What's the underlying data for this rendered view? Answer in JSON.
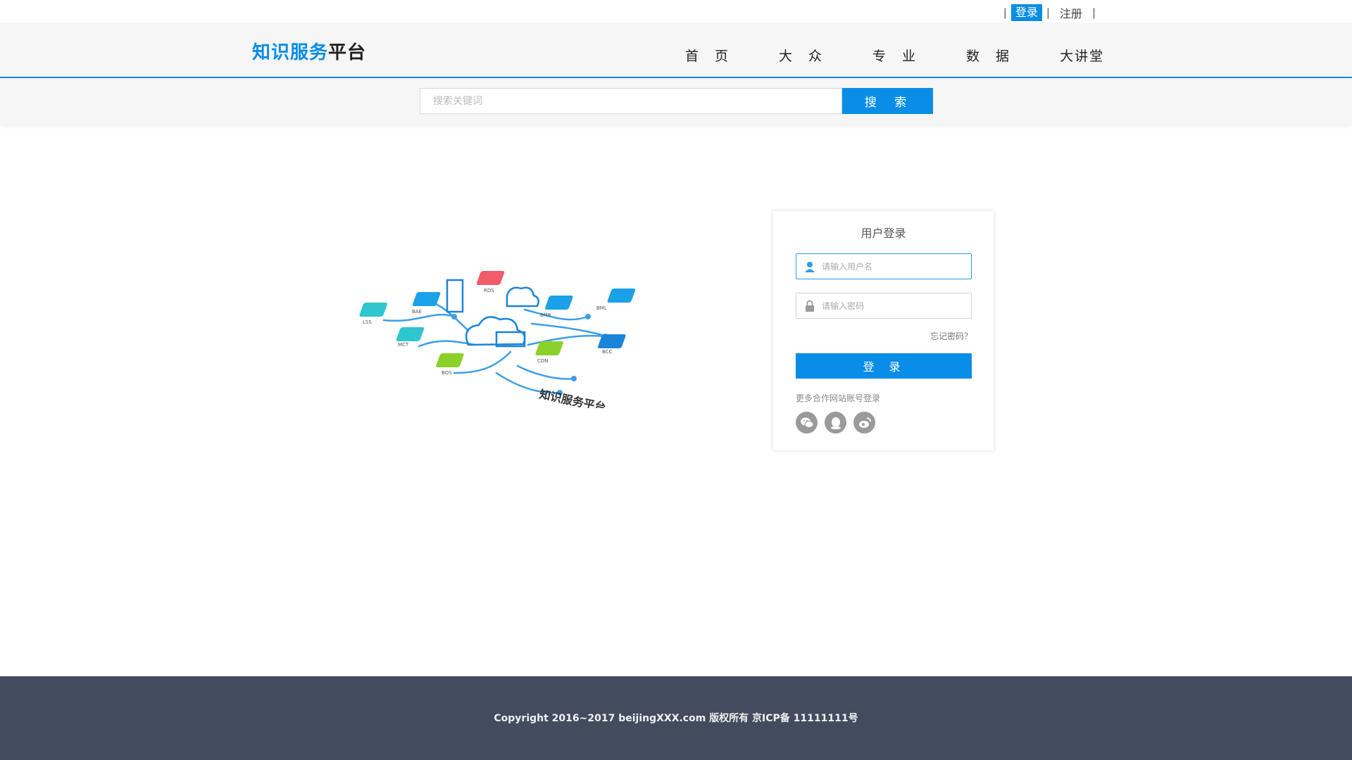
{
  "topbar": {
    "separator": "|",
    "login_label": "登录",
    "register_label": "注册"
  },
  "header": {
    "logo_blue": "知识服务",
    "logo_dark": "平台",
    "nav": [
      "首　页",
      "大　众",
      "专　业",
      "数　据",
      "大讲堂"
    ]
  },
  "search": {
    "placeholder": "搜索关键词",
    "button_label": "搜 索"
  },
  "illustration": {
    "tags": [
      "RDS",
      "BAE",
      "LSS",
      "MCT",
      "BOS",
      "CDN",
      "BMR",
      "BML",
      "BCC"
    ],
    "caption": "知识服务平台"
  },
  "login": {
    "title": "用户登录",
    "username_placeholder": "请输入用户名",
    "password_placeholder": "请输入密码",
    "forgot_label": "忘记密码？",
    "submit_label": "登 录",
    "partner_text": "更多合作网站账号登录",
    "socials": [
      "wechat-icon",
      "qq-icon",
      "weibo-icon"
    ]
  },
  "footer": {
    "copyright": "Copyright 2016~2017 beijingXXX.com 版权所有 京ICP备 11111111号"
  },
  "colors": {
    "accent": "#0a8de6",
    "footer_bg": "#434c5e",
    "header_bg": "#f6f6f6"
  }
}
